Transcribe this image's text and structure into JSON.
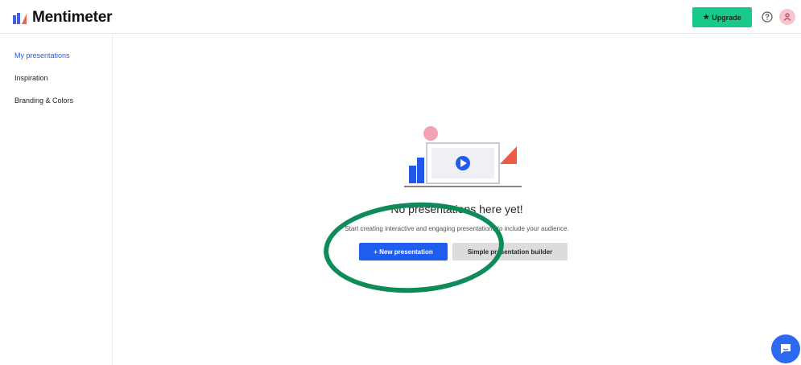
{
  "header": {
    "brand_name": "Mentimeter",
    "upgrade_label": "Upgrade"
  },
  "sidebar": {
    "items": [
      {
        "label": "My presentations",
        "active": true
      },
      {
        "label": "Inspiration",
        "active": false
      },
      {
        "label": "Branding & Colors",
        "active": false
      }
    ]
  },
  "main": {
    "empty_title": "No presentations here yet!",
    "empty_subtitle": "Start creating interactive and engaging presentations to include your audience.",
    "new_presentation_label": "+ New presentation",
    "simple_builder_label": "Simple presentation builder"
  },
  "colors": {
    "accent": "#1f5cf0",
    "upgrade": "#19c98a",
    "annotation": "#0e8b58",
    "avatar_bg": "#f7c5cf"
  },
  "icons": {
    "logo": "mentimeter-logo-icon",
    "upgrade": "star-icon",
    "help": "help-circle-icon",
    "avatar": "user-icon",
    "chat": "chat-bubble-icon",
    "play": "play-icon"
  }
}
